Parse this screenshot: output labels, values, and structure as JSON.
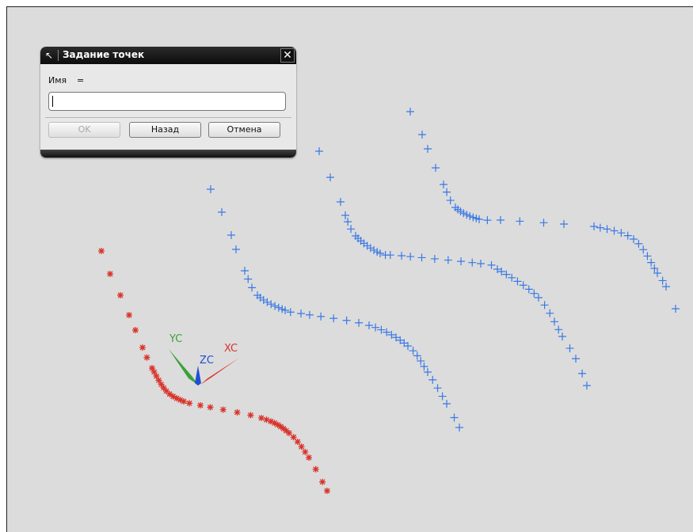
{
  "dialog": {
    "title": "Задание точек",
    "name_label": "Имя",
    "equals": "=",
    "name_value": "",
    "ok_label": "OK",
    "back_label": "Назад",
    "cancel_label": "Отмена",
    "title_icon": "arrow-icon",
    "close_icon": "close-icon"
  },
  "triad": {
    "xc": "XC",
    "yc": "YC",
    "zc": "ZC"
  },
  "colors": {
    "background": "#dcdcdc",
    "blue_points": "#3a78e6",
    "red_points": "#d9332a",
    "xc_axis": "#d9332a",
    "yc_axis": "#3aa13a",
    "zc_axis": "#1f4fd1"
  }
}
